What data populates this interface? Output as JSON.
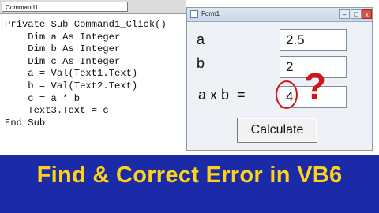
{
  "editor": {
    "object_combo": "Command1",
    "code_lines": [
      "Private Sub Command1_Click()",
      "    Dim a As Integer",
      "    Dim b As Integer",
      "    Dim c As Integer",
      "    a = Val(Text1.Text)",
      "    b = Val(Text2.Text)",
      "    c = a * b",
      "    Text3.Text = c",
      "End Sub"
    ]
  },
  "form": {
    "title": "Form1",
    "label_a": "a",
    "label_b": "b",
    "label_result": "a x b  =",
    "text1": "2.5",
    "text2": "2",
    "text3": "4",
    "calculate_label": "Calculate",
    "close_glyph": "x"
  },
  "annotation": {
    "question_mark": "?",
    "color": "#d0161b"
  },
  "banner": {
    "text": "Find & Correct Error in VB6",
    "bg_color": "#1b2aa6",
    "text_color": "#ffd21a"
  }
}
